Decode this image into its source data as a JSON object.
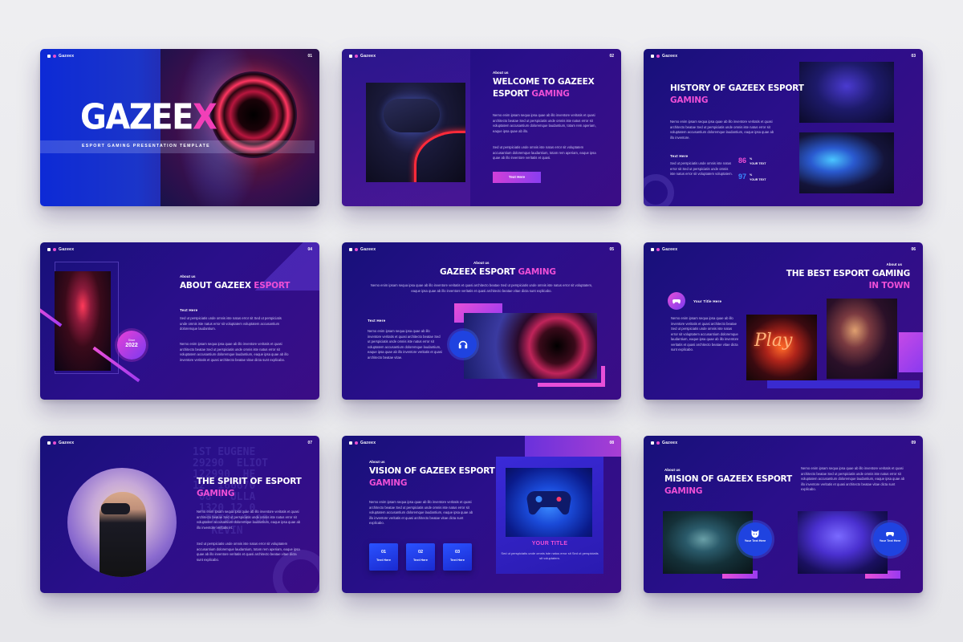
{
  "brand": "Gazeex",
  "slides": [
    {
      "page": "01",
      "title_main": "GAZEE",
      "title_accent": "X",
      "tagline": "ESPORT GAMING PRESENTATION TEMPLATE"
    },
    {
      "page": "02",
      "kicker": "About us",
      "title_line1": "WELCOME TO GAZEEX",
      "title_line2": "ESPORT",
      "title_accent": "GAMING",
      "para1": "Nemo enim ipsam sequa ipsa quae ab illo inventore veritatis et quasi architecto beatae Sed ut perspiciatis unde omnis iste natus error sit voluptatem accusantium doloremque laudantium, totam rem aperiam, eaque ipsa quae ab illo.",
      "para2": "Sed ut perspiciatis unde omnis iste natus error sit voluptatem accusantium doloremque laudantium, totam rem aperiam, eaque ipsa quae ab illo inventore veritatis et quasi.",
      "button": "Text Here"
    },
    {
      "page": "03",
      "title_line1": "HISTORY OF GAZEEX ESPORT",
      "title_accent": "GAMING",
      "para1": "Nemo enim ipsam sequa ipsa quae ab illo inventore veritatis et quasi architecto beatae Sed ut perspiciatis unde omnis iste natus error sit voluptatem accusantium doloremque laudantium, eaque ipsa quae ab illo inventore.",
      "subhead": "Text Here",
      "para2": "Sed ut perspiciatis unde omnis iste natus error sit Sed ut perspiciatis unde omnis iste natus error sit voluptatem voluptatem.",
      "stat1_value": "86",
      "stat1_unit": "%",
      "stat1_label": "YOUR TEXT",
      "stat2_value": "97",
      "stat2_unit": "%",
      "stat2_label": "YOUR TEXT",
      "stat1_color": "#ee4fd6",
      "stat2_color": "#3a8aff"
    },
    {
      "page": "04",
      "kicker": "About us",
      "title_line1": "ABOUT GAZEEX",
      "title_accent": "ESPORT",
      "subhead": "Text Here",
      "para1": "Sed ut perspiciatis unde omnis iste natus error sit Sed ut perspiciatis unde omnis iste natus error sit voluptatem voluptatem accusantium doloremque laudantium.",
      "para2": "Nemo enim ipsam sequa ipsa quae ab illo inventore veritatis et quasi architecto beatae Sed ut perspiciatis unde omnis iste natus error sit voluptatem accusantium doloremque laudantium, eaque ipsa quae ab illo inventore veritatis et quasi architecto beatae vitae dicta sunt explicabo.",
      "since_label": "Since",
      "since_year": "2022"
    },
    {
      "page": "05",
      "kicker": "About us",
      "title_line1": "GAZEEX ESPORT",
      "title_accent": "GAMING",
      "intro": "Nemo enim ipsam sequa ipsa quae ab illo inventore veritatis et quasi architecto beatae Sed ut perspiciatis unde omnis iste natus error sit voluptatem, eaque ipsa quae ab illo inventore veritatis et quasi architecto beatae vitae dicta sunt explicabo.",
      "subhead": "Text Here",
      "para1": "Nemo enim ipsam sequa ipsa quae ab illo inventore veritatis et quasi architecto beatae Sed ut perspiciatis unde omnis iste natus error sit voluptatem accusantium doloremque laudantium, eaque ipsa quae ab illo inventore veritatis et quasi architecto beatae vitae."
    },
    {
      "page": "06",
      "kicker": "About us",
      "title_line1": "THE BEST ESPORT GAMING",
      "title_accent": "IN TOWN",
      "icon_title": "Your Title Here",
      "para1": "Nemo enim ipsam sequa ipsa quae ab illo inventore veritatis et quasi architecto beatae Sed ut perspiciatis unde omnis iste natus error sit voluptatem accusantium doloremque laudantium, eaque ipsa quae ab illo inventore veritatis et quasi architecto beatae vitae dicta sunt explicabo.",
      "play_text": "Play"
    },
    {
      "page": "07",
      "title_line1": "THE SPIRIT OF ESPORT",
      "title_accent": "GAMING",
      "para1": "Nemo enim ipsam sequa ipsa quae ab illo inventore veritatis et quasi architecto beatae Sed ut perspiciatis unde omnis iste natus error sit voluptatem accusantium doloremque laudantium, eaque ipsa quae ab illo inventore veritatis et.",
      "para2": "Sed ut perspiciatis unde omnis iste natus error sit voluptatem accusantium doloremque laudantium, totam rem aperiam, eaque ipsa quae ab illo inventore veritatis et quasi architecto beatae vitae dicta sunt explicabo.",
      "numwall": "1ST EUGENE\n29290  ELIOT\n122990  HE\n12  166670\n 08 · ULLA\n 1320 12.0\n  TOTAL 1 00\n   KEVIN"
    },
    {
      "page": "08",
      "kicker": "About us",
      "title_line1": "VISION OF GAZEEX ESPORT",
      "title_accent": "GAMING",
      "para1": "Nemo enim ipsam sequa ipsa quae ab illo inventore veritatis et quasi architecto beatae Sed ut perspiciatis unde omnis iste natus error sit voluptatem accusantium doloremque laudantium, eaque ipsa quae ab illo inventore veritatis et quasi architecto beatae vitae dicta sunt explicabo.",
      "boxes": [
        {
          "num": "01",
          "label": "Text Here"
        },
        {
          "num": "02",
          "label": "Text Here"
        },
        {
          "num": "03",
          "label": "Text Here"
        }
      ],
      "your_title": "YOUR TITLE",
      "your_text": "Sed ut perspiciatis unde omnis iste natus error sit Sed ut perspiciatis sit voluptatem."
    },
    {
      "page": "09",
      "kicker": "About us",
      "title_line1": "MISION OF GAZEEX ESPORT",
      "title_accent": "GAMING",
      "para1": "Nemo enim ipsam sequa ipsa quae ab illo inventore veritatis et quasi architecto beatae Sed ut perspiciatis unde omnis iste natus error sit voluptatem accusantium doloremque laudantium, eaque ipsa quae ab illo inventore veritatis et quasi architecto beatae vitae dicta sunt explicabo.",
      "badge1": "Your Text Here",
      "badge2": "Your Text Here"
    }
  ],
  "colors": {
    "accent_pink": "#ee4fd6",
    "accent_blue": "#1f43e0",
    "slide_bg": "#2a0f8a",
    "page_bg": "#eeeef1"
  },
  "icons": {
    "controller": "gamepad-icon",
    "headphones": "headphones-icon",
    "cat": "cat-icon"
  }
}
